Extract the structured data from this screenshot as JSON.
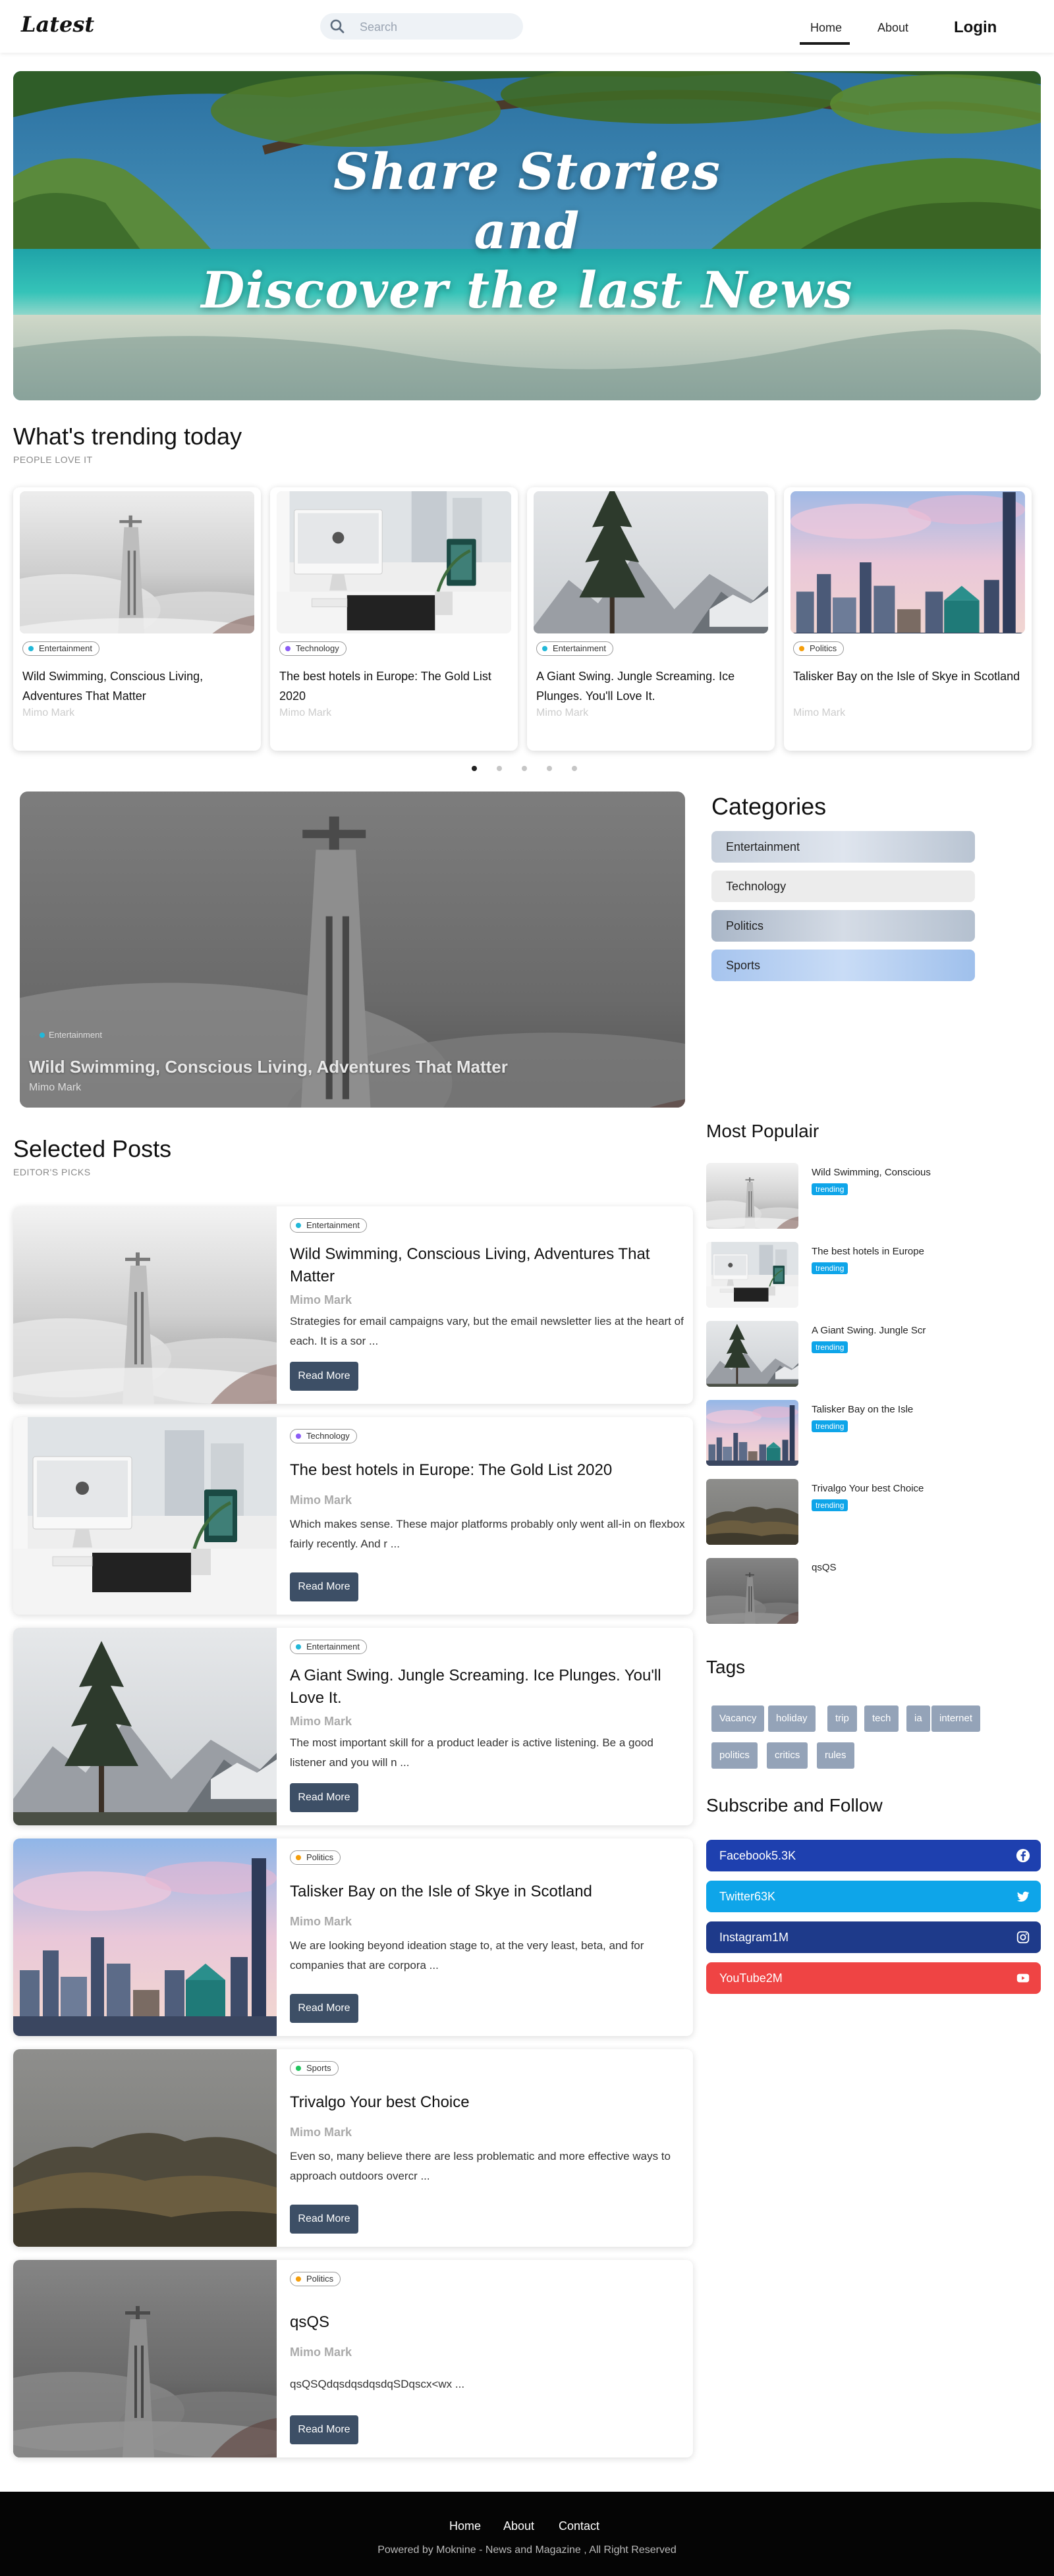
{
  "nav": {
    "logo": "Latest",
    "search_placeholder": "Search",
    "links": [
      "Home",
      "About"
    ],
    "login": "Login"
  },
  "hero": {
    "lines": [
      "Share Stories",
      "and",
      "Discover the last News"
    ]
  },
  "trending": {
    "title": "What's trending today",
    "subtitle": "PEOPLE LOVE IT",
    "cards": [
      {
        "category": "Entertainment",
        "cat_color": "#22b8d8",
        "title": "Wild Swimming, Conscious Living, Adventures That Matter",
        "author": "Mimo Mark",
        "image": "tower-fog"
      },
      {
        "category": "Technology",
        "cat_color": "#8b5cf6",
        "title": "The best hotels in Europe: The Gold List 2020",
        "author": "Mimo Mark",
        "image": "desk-imac"
      },
      {
        "category": "Entertainment",
        "cat_color": "#22b8d8",
        "title": "A Giant Swing. Jungle Screaming. Ice Plunges. You'll Love It.",
        "author": "Mimo Mark",
        "image": "pine-tree"
      },
      {
        "category": "Politics",
        "cat_color": "#f59e0b",
        "title": "Talisker Bay on the Isle of Skye in Scotland",
        "author": "Mimo Mark",
        "image": "city-skyline"
      }
    ],
    "active_dot": 0,
    "dot_count": 5
  },
  "feature": {
    "category": "Entertainment",
    "cat_color": "#22b8d8",
    "title": "Wild Swimming, Conscious Living, Adventures That Matter",
    "author": "Mimo Mark"
  },
  "categories": {
    "title": "Categories",
    "items": [
      "Entertainment",
      "Technology",
      "Politics",
      "Sports"
    ]
  },
  "selected": {
    "title": "Selected Posts",
    "subtitle": "EDITOR'S PICKS",
    "read_more": "Read More",
    "posts": [
      {
        "category": "Entertainment",
        "cat_color": "#22b8d8",
        "title": "Wild Swimming, Conscious Living, Adventures That Matter",
        "author": "Mimo Mark",
        "excerpt": "Strategies for email campaigns vary, but the email newsletter lies at the heart of each. It is a sor ...",
        "image": "tower-fog"
      },
      {
        "category": "Technology",
        "cat_color": "#8b5cf6",
        "title": "The best hotels in Europe: The Gold List 2020",
        "author": "Mimo Mark",
        "excerpt": "Which makes sense. These major platforms probably only went all-in on flexbox fairly recently. And r ...",
        "image": "desk-imac"
      },
      {
        "category": "Entertainment",
        "cat_color": "#22b8d8",
        "title": "A Giant Swing. Jungle Screaming. Ice Plunges. You'll Love It.",
        "author": "Mimo Mark",
        "excerpt": "The most important skill for a product leader is active listening. Be a good listener and you will n ...",
        "image": "pine-tree"
      },
      {
        "category": "Politics",
        "cat_color": "#f59e0b",
        "title": "Talisker Bay on the Isle of Skye in Scotland",
        "author": "Mimo Mark",
        "excerpt": "We are looking beyond ideation stage to, at the very least, beta, and for companies that are corpora ...",
        "image": "city-skyline"
      },
      {
        "category": "Sports",
        "cat_color": "#22c55e",
        "title": "Trivalgo Your best Choice",
        "author": "Mimo Mark",
        "excerpt": "Even so, many believe there are less problematic and more effective ways to approach outdoors overcr ...",
        "image": "hills"
      },
      {
        "category": "Politics",
        "cat_color": "#f59e0b",
        "title": "qsQS",
        "author": "Mimo Mark",
        "excerpt": "qsQSQdqsdqsdqsdqSDqscx<wx ...",
        "image": "tower-fog-dark"
      }
    ]
  },
  "popular": {
    "title": "Most Populair",
    "trending_label": "trending",
    "items": [
      {
        "title": "Wild Swimming, Conscious",
        "trending": true,
        "image": "tower-fog"
      },
      {
        "title": "The best hotels in Europe",
        "trending": true,
        "image": "desk-imac"
      },
      {
        "title": "A Giant Swing. Jungle Scr",
        "trending": true,
        "image": "pine-tree"
      },
      {
        "title": "Talisker Bay on the Isle",
        "trending": true,
        "image": "city-skyline"
      },
      {
        "title": "Trivalgo Your best Choice",
        "trending": true,
        "image": "hills"
      },
      {
        "title": "qsQS",
        "trending": false,
        "image": "tower-fog-dark"
      }
    ]
  },
  "tags": {
    "title": "Tags",
    "items": [
      "Vacancy",
      "holiday",
      "trip",
      "tech",
      "ia",
      "internet",
      "politics",
      "critics",
      "rules"
    ]
  },
  "subscribe": {
    "title": "Subscribe and Follow",
    "items": [
      {
        "label": "Facebook5.3K",
        "color": "#1e40af",
        "icon": "facebook-icon"
      },
      {
        "label": "Twitter63K",
        "color": "#0ea5e9",
        "icon": "twitter-icon"
      },
      {
        "label": "Instagram1M",
        "color": "#1e3a8a",
        "icon": "instagram-icon"
      },
      {
        "label": "YouTube2M",
        "color": "#ef4444",
        "icon": "youtube-icon"
      }
    ]
  },
  "footer": {
    "links": [
      "Home",
      "About",
      "Contact"
    ],
    "copyright": "Powered by Moknine - News and Magazine , All Right Reserved"
  }
}
